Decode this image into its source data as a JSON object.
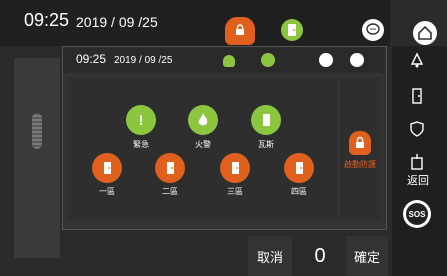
{
  "status_bar": {
    "time": "09:25",
    "date": "2019 / 09 /25"
  },
  "popup": {
    "time": "09:25",
    "date": "2019 / 09 /25",
    "sensors": [
      {
        "label": "緊急",
        "icon": "exclamation-icon",
        "color": "#8cc63f"
      },
      {
        "label": "火警",
        "icon": "fire-icon",
        "color": "#8cc63f"
      },
      {
        "label": "瓦斯",
        "icon": "gas-icon",
        "color": "#8cc63f"
      },
      {
        "label": "一區",
        "icon": "door-icon",
        "color": "#e0601e"
      },
      {
        "label": "二區",
        "icon": "door-icon",
        "color": "#e0601e"
      },
      {
        "label": "三區",
        "icon": "door-icon",
        "color": "#e0601e"
      },
      {
        "label": "四區",
        "icon": "door-icon",
        "color": "#e0601e"
      }
    ],
    "arm_label": "啟動防護"
  },
  "sidebar": {
    "back_label": "返回",
    "sos_label": "SOS"
  },
  "keypad": {
    "cancel_label": "取消",
    "value": "0",
    "confirm_label": "確定"
  },
  "colors": {
    "accent_green": "#8cc63f",
    "accent_orange": "#e0601e"
  }
}
